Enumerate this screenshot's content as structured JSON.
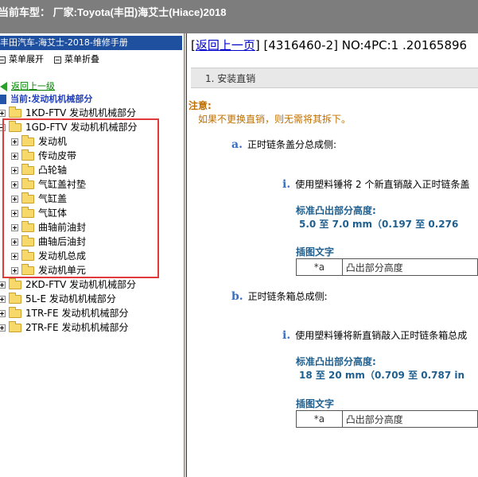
{
  "topbar": {
    "title": "当前车型：  厂家:Toyota(丰田)海艾士(Hiace)2018"
  },
  "left_panel": {
    "title": "丰田汽车-海艾士-2018-维修手册",
    "expand_label": "菜单展开",
    "collapse_label": "菜单折叠",
    "back_label": "返回上一级",
    "current_label": "当前:发动机机械部分",
    "tree": [
      {
        "label": "1KD-FTV 发动机机械部分",
        "state": "collapsed",
        "level": 0
      },
      {
        "label": "1GD-FTV 发动机机械部分",
        "state": "expanded",
        "level": 0
      },
      {
        "label": "发动机",
        "state": "collapsed",
        "level": 1
      },
      {
        "label": "传动皮带",
        "state": "collapsed",
        "level": 1
      },
      {
        "label": "凸轮轴",
        "state": "collapsed",
        "level": 1
      },
      {
        "label": "气缸盖衬垫",
        "state": "collapsed",
        "level": 1
      },
      {
        "label": "气缸盖",
        "state": "collapsed",
        "level": 1
      },
      {
        "label": "气缸体",
        "state": "collapsed",
        "level": 1
      },
      {
        "label": "曲轴前油封",
        "state": "collapsed",
        "level": 1
      },
      {
        "label": "曲轴后油封",
        "state": "collapsed",
        "level": 1
      },
      {
        "label": "发动机总成",
        "state": "collapsed",
        "level": 1
      },
      {
        "label": "发动机单元",
        "state": "collapsed",
        "level": 1
      },
      {
        "label": "2KD-FTV 发动机机械部分",
        "state": "collapsed",
        "level": 0
      },
      {
        "label": "5L-E 发动机机械部分",
        "state": "collapsed",
        "level": 0
      },
      {
        "label": "1TR-FE 发动机机械部分",
        "state": "collapsed",
        "level": 0
      },
      {
        "label": "2TR-FE 发动机机械部分",
        "state": "collapsed",
        "level": 0
      }
    ]
  },
  "right_panel": {
    "back_link": "返回上一页",
    "doc_id": "[4316460-2] NO:4PC:1 .20165896",
    "step_title": "1. 安装直销",
    "note_title": "注意:",
    "note_text": "如果不更换直销，则无需将其拆下。",
    "sections": [
      {
        "letter": "a.",
        "title": "正时链条盖分总成侧:",
        "item_letter": "i.",
        "item_text": "使用塑料锤将 2 个新直销敲入正时链条盖",
        "std_title": "标准凸出部分高度:",
        "std_value": "5.0 至 7.0 mm（0.197 至 0.276",
        "caption_title": "插图文字",
        "caption_key": "*a",
        "caption_value": "凸出部分高度"
      },
      {
        "letter": "b.",
        "title": "正时链条箱总成侧:",
        "item_letter": "i.",
        "item_text": "使用塑料锤将新直销敲入正时链条箱总成",
        "std_title": "标准凸出部分高度:",
        "std_value": "18 至 20 mm（0.709 至 0.787 in",
        "caption_title": "插图文字",
        "caption_key": "*a",
        "caption_value": "凸出部分高度"
      }
    ]
  }
}
